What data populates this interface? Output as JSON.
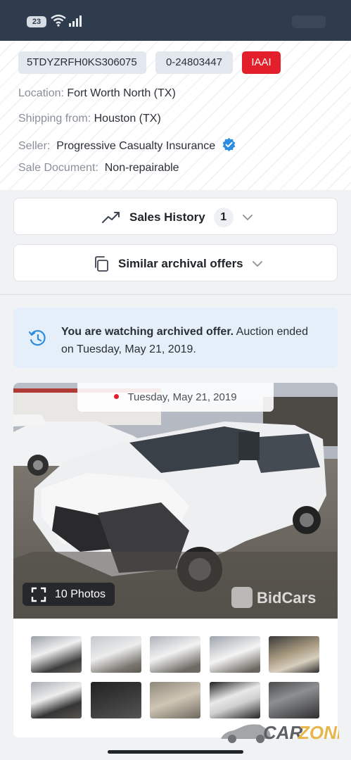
{
  "status_bar": {
    "battery_level": "23",
    "wifi_icon": "wifi-icon",
    "signal_icon": "cellular-signal-icon"
  },
  "vehicle": {
    "vin": "5TDYZRFH0KS306075",
    "lot_number": "0-24803447",
    "auction_badge": "IAAI",
    "auction_badge_color": "#e21f2a",
    "location_label": "Location:",
    "location_value": "Fort Worth North (TX)",
    "shipping_label": "Shipping from:",
    "shipping_value": "Houston (TX)",
    "seller_label": "Seller:",
    "seller_value": "Progressive Casualty Insurance",
    "seller_verified_icon": "verified-badge-icon",
    "sale_document_label": "Sale Document:",
    "sale_document_value": "Non-repairable"
  },
  "sales_history": {
    "label": "Sales History",
    "count": "1",
    "icon": "trend-line-icon"
  },
  "similar_offers": {
    "label": "Similar archival offers",
    "icon": "copy-icon"
  },
  "archive_notice": {
    "bold": "You are watching archived offer.",
    "rest": " Auction ended on Tuesday, May 21, 2019.",
    "icon": "history-icon",
    "background": "#e4eff9"
  },
  "gallery": {
    "date": "Tuesday, May 21, 2019",
    "photos_label": "10 Photos",
    "watermark": "BidCars",
    "thumbnail_count": 10
  },
  "footer_watermark": {
    "car": "CAR",
    "zone": "ZONE"
  }
}
